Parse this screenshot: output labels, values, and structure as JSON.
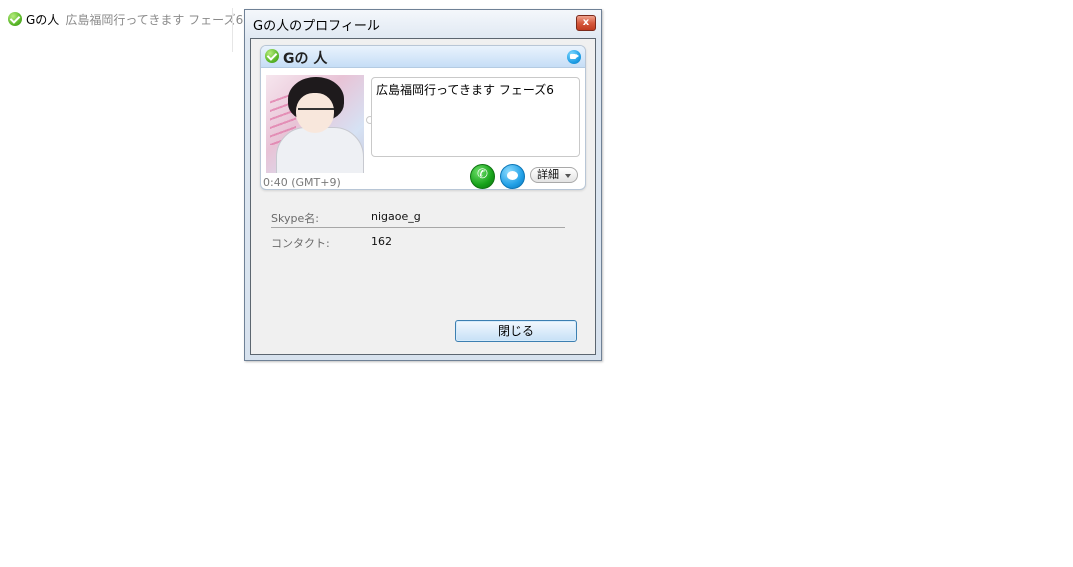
{
  "contact_strip": {
    "name": "Gの人",
    "mood": "広島福岡行ってきます  フェーズ6"
  },
  "window": {
    "title": "Gの人のプロフィール",
    "close_glyph": "x"
  },
  "profile": {
    "display_name": "Gの 人",
    "mood_message": "広島福岡行ってきます  フェーズ6",
    "local_time": "0:40 (GMT+9)",
    "details_label": "詳細"
  },
  "info": {
    "skype_name_label": "Skype名:",
    "skype_name_value": "nigaoe_g",
    "contacts_label": "コンタクト:",
    "contacts_value": "162"
  },
  "buttons": {
    "close_label": "閉じる"
  }
}
